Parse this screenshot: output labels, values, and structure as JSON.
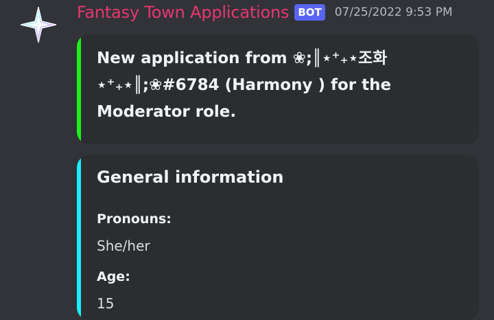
{
  "message": {
    "username": "Fantasy Town Applications",
    "bot_tag": "BOT",
    "timestamp": "07/25/2022 9:53 PM",
    "avatar_icon": "sparkle-star-icon",
    "username_color": "#e8366e"
  },
  "embeds": [
    {
      "accent_color": "#1cf01f",
      "title": "New application from ❀;║⋆⁺₊⋆조화 ⋆⁺₊⋆║;❀#6784 (Harmony ) for the Moderator role."
    },
    {
      "accent_color": "#19f0ff",
      "title": "General information",
      "fields": [
        {
          "name": "Pronouns:",
          "value": "She/her"
        },
        {
          "name": "Age:",
          "value": "15"
        }
      ]
    }
  ]
}
